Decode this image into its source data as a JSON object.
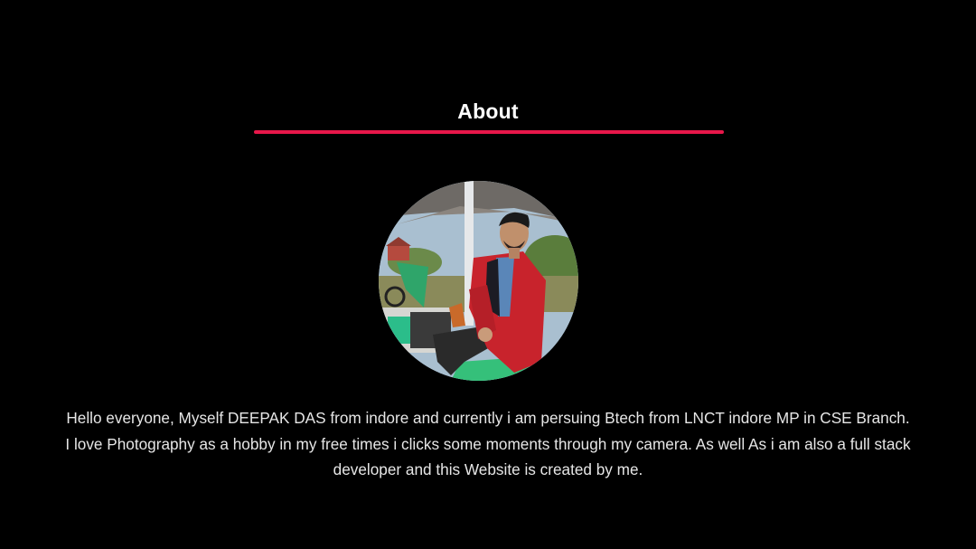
{
  "about": {
    "title": "About",
    "accent_color": "#e8174a",
    "avatar_icon": "profile-photo",
    "bio": "Hello everyone, Myself DEEPAK DAS from indore and currently i am persuing Btech from LNCT indore MP in CSE Branch. I love Photography as a hobby in my free times i clicks some moments through my camera. As well As i am also a full stack developer and this Website is created by me."
  }
}
